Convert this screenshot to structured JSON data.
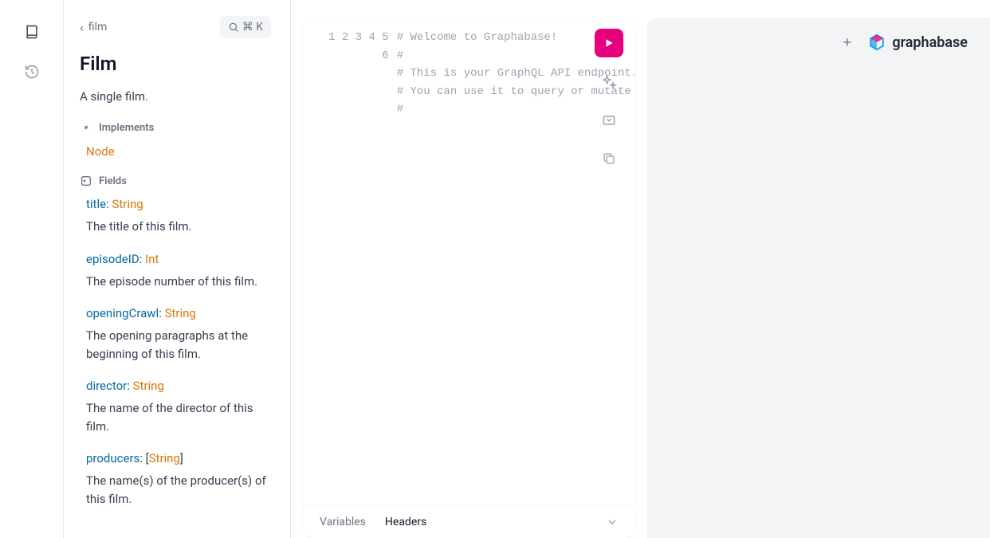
{
  "breadcrumb": {
    "label": "film"
  },
  "search": {
    "shortcut": "⌘ K"
  },
  "schema": {
    "title": "Film",
    "description": "A single film.",
    "implements_label": "Implements",
    "implements_value": "Node",
    "fields_label": "Fields",
    "fields": [
      {
        "name": "title",
        "type": "String",
        "list": false,
        "desc": "The title of this film."
      },
      {
        "name": "episodeID",
        "type": "Int",
        "list": false,
        "desc": "The episode number of this film."
      },
      {
        "name": "openingCrawl",
        "type": "String",
        "list": false,
        "desc": "The opening paragraphs at the beginning of this film."
      },
      {
        "name": "director",
        "type": "String",
        "list": false,
        "desc": "The name of the director of this film."
      },
      {
        "name": "producers",
        "type": "String",
        "list": true,
        "desc": "The name(s) of the producer(s) of this film."
      }
    ]
  },
  "editor": {
    "lines": [
      "# Welcome to Graphabase!",
      "#",
      "# This is your GraphQL API endpoint.",
      "# You can use it to query or mutate",
      "#",
      ""
    ],
    "line_numbers": [
      "1",
      "2",
      "3",
      "4",
      "5",
      "6"
    ],
    "tabs": {
      "variables": "Variables",
      "headers": "Headers"
    }
  },
  "brand": {
    "name": "graphabase"
  }
}
